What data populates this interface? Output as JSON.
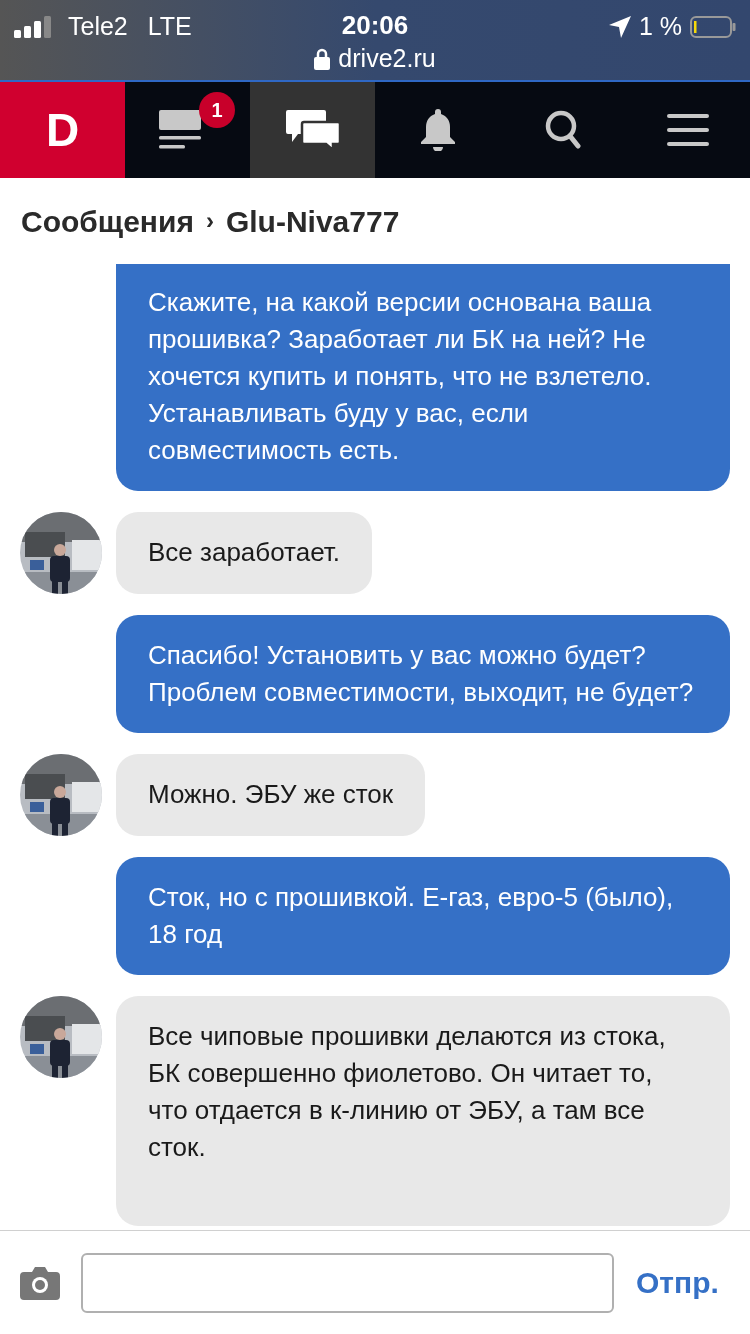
{
  "status_bar": {
    "carrier": "Tele2",
    "network": "LTE",
    "time": "20:06",
    "url": "drive2.ru",
    "battery": "1 %"
  },
  "nav": {
    "logo": "D",
    "tabs": [
      {
        "kind": "feed",
        "selected": false,
        "badge": "1"
      },
      {
        "kind": "messages",
        "selected": true
      },
      {
        "kind": "notifications",
        "selected": false
      },
      {
        "kind": "search",
        "selected": false
      },
      {
        "kind": "menu",
        "selected": false
      }
    ]
  },
  "breadcrumb": {
    "section": "Сообщения",
    "separator": "›",
    "contact": "Glu-Niva777"
  },
  "messages": [
    {
      "kind": "outgoing",
      "text": "Скажите, на какой версии основана ваша прошивка? Заработает ли БК на ней? Не хочется купить и понять, что не взлетело. Устанавливать буду у вас, если совместимость есть."
    },
    {
      "kind": "incoming",
      "text": "Все заработает."
    },
    {
      "kind": "outgoing",
      "text": "Спасибо! Установить у вас можно будет? Проблем совместимости, выходит, не будет?"
    },
    {
      "kind": "incoming",
      "text": "Можно. ЭБУ же сток"
    },
    {
      "kind": "outgoing",
      "text": "Сток, но с прошивкой. Е-газ, евро-5 (было), 18 год"
    },
    {
      "kind": "incoming",
      "text": "Все чиповые прошивки делаются из стока, БК совершенно фиолетово. Он читает то, что отдается в к-линию от ЭБУ, а там все сток."
    }
  ],
  "composer": {
    "send": "Отпр."
  }
}
